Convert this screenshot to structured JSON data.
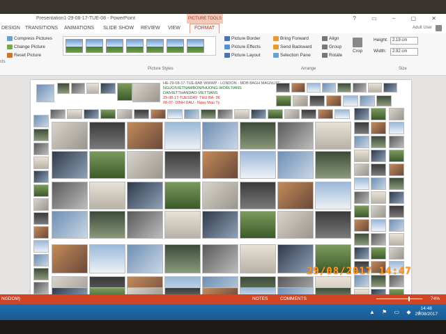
{
  "window": {
    "title": "Presentation1-29-08-17-TUE-08 - PowerPoint",
    "contextual_tab": "PICTURE TOOLS"
  },
  "tabs": [
    "DESIGN",
    "TRANSITIONS",
    "ANIMATIONS",
    "SLIDE SHOW",
    "REVIEW",
    "VIEW",
    "FORMAT"
  ],
  "active_tab": "FORMAT",
  "user": "Adult User",
  "ribbon": {
    "adjust": {
      "compress": "Compress Pictures",
      "change": "Change Picture",
      "reset": "Reset Picture",
      "cut_label": "cts"
    },
    "styles_label": "Picture Styles",
    "picture_border": "Picture Border",
    "picture_effects": "Picture Effects",
    "picture_layout": "Picture Layout",
    "arrange": {
      "bring_forward": "Bring Forward",
      "send_backward": "Send Backward",
      "selection_pane": "Selection Pane",
      "align": "Align",
      "group": "Group",
      "rotate": "Rotate",
      "label": "Arrange"
    },
    "crop": "Crop",
    "size": {
      "height_label": "Height:",
      "height": "2.19 cm",
      "width_label": "Width:",
      "width": "2.92 cm",
      "label": "Size"
    }
  },
  "slide": {
    "text_lines": [
      "HE-29-08-17-TUE-8AB WWWP - LONDON - MDB 8AGH MAGNUSE",
      "NGUOIVIETNAMBONPHUONG-WORLTIANS",
      "DAIVIETTHANDAO-VIETTIANS",
      "29-08-17-TUESDAY- THU BA- 06",
      "08-07- DINH DAU - Ngay Mau Ty"
    ]
  },
  "photo_stamp": "29/08/2017  14:47",
  "status": {
    "language": "NGDOM)",
    "notes": "NOTES",
    "comments": "COMMENTS",
    "zoom": "74%"
  },
  "taskbar": {
    "time": "14:48",
    "date": "29/08/2017"
  },
  "colors": {
    "accent": "#d14424",
    "taskbar": "#1f6fb0",
    "stamp": "#ff9c1e"
  }
}
